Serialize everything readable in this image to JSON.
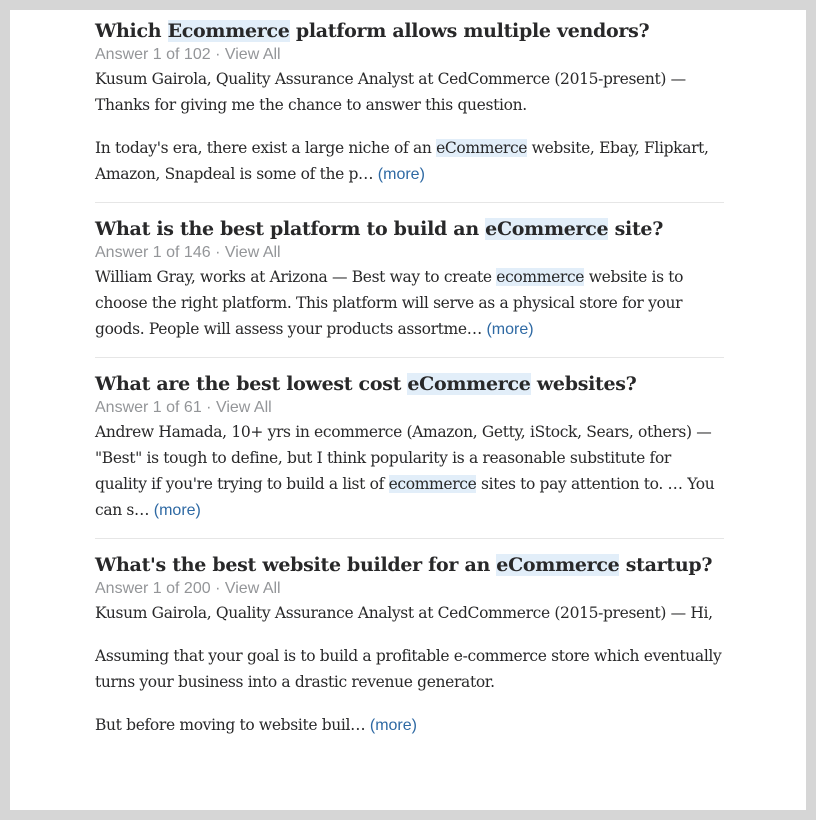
{
  "results": [
    {
      "title_parts": [
        {
          "text": "Which ",
          "highlight": false
        },
        {
          "text": "Ecommerce",
          "highlight": true
        },
        {
          "text": " platform allows multiple vendors?",
          "highlight": false
        }
      ],
      "answer_info": "Answer 1 of 102",
      "separator": "·",
      "view_all": "View All",
      "paragraphs": [
        [
          {
            "text": "Kusum Gairola, Quality Assurance Analyst at CedCommerce (2015-present) — Thanks for giving me the chance to answer this question.",
            "highlight": false
          }
        ],
        [
          {
            "text": "In today's era, there exist a large niche of an ",
            "highlight": false
          },
          {
            "text": "eCommerce",
            "highlight": true
          },
          {
            "text": " website, Ebay, Flipkart, Amazon, Snapdeal is some of the p… ",
            "highlight": false
          }
        ]
      ],
      "more_label": "(more)"
    },
    {
      "title_parts": [
        {
          "text": "What is the best platform to build an ",
          "highlight": false
        },
        {
          "text": "eCommerce",
          "highlight": true
        },
        {
          "text": " site?",
          "highlight": false
        }
      ],
      "answer_info": "Answer 1 of 146",
      "separator": "·",
      "view_all": "View All",
      "paragraphs": [
        [
          {
            "text": "William Gray, works at Arizona — Best way to create ",
            "highlight": false
          },
          {
            "text": "ecommerce",
            "highlight": true
          },
          {
            "text": " website is to choose the right platform. This platform will serve as a physical store for your goods. People will assess your products assortme… ",
            "highlight": false
          }
        ]
      ],
      "more_label": "(more)"
    },
    {
      "title_parts": [
        {
          "text": "What are the best lowest cost ",
          "highlight": false
        },
        {
          "text": "eCommerce",
          "highlight": true
        },
        {
          "text": " websites?",
          "highlight": false
        }
      ],
      "answer_info": "Answer 1 of 61",
      "separator": "·",
      "view_all": "View All",
      "paragraphs": [
        [
          {
            "text": "Andrew Hamada, 10+ yrs in ecommerce (Amazon, Getty, iStock, Sears, others) — \"Best\" is tough to define, but I think popularity is a reasonable substitute for quality if you're trying to build a list of ",
            "highlight": false
          },
          {
            "text": "ecommerce",
            "highlight": true
          },
          {
            "text": " sites to pay attention to. … You can s… ",
            "highlight": false
          }
        ]
      ],
      "more_label": "(more)"
    },
    {
      "title_parts": [
        {
          "text": "What's the best website builder for an ",
          "highlight": false
        },
        {
          "text": "eCommerce",
          "highlight": true
        },
        {
          "text": " startup?",
          "highlight": false
        }
      ],
      "answer_info": "Answer 1 of 200",
      "separator": "·",
      "view_all": "View All",
      "paragraphs": [
        [
          {
            "text": "Kusum Gairola, Quality Assurance Analyst at CedCommerce (2015-present) — Hi,",
            "highlight": false
          }
        ],
        [
          {
            "text": "Assuming that your goal is to build a profitable e-commerce store which eventually turns your business into a drastic revenue generator.",
            "highlight": false
          }
        ],
        [
          {
            "text": "But before moving to website buil… ",
            "highlight": false
          }
        ]
      ],
      "more_label": "(more)"
    }
  ],
  "colors": {
    "highlight_bg": "#e2eef9",
    "link": "#2e69a3",
    "meta": "#939598",
    "text": "#282829"
  }
}
